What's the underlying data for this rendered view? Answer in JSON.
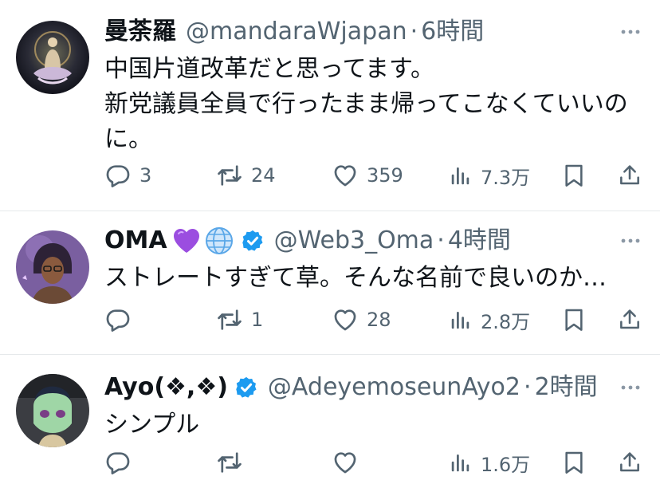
{
  "tweets": [
    {
      "name": "曼荼羅",
      "handle": "@mandaraWjapan",
      "dot": "·",
      "time": "6時間",
      "text_lines": [
        "中国片道改革だと思ってます。",
        "新党議員全員で行ったまま帰ってこなくていいの",
        "に。"
      ],
      "replies": "3",
      "retweets": "24",
      "likes": "359",
      "views": "7.3万"
    },
    {
      "name": "OMA",
      "name_emoji": "💜🌐",
      "handle": "@Web3_Oma",
      "dot": "·",
      "time": "4時間",
      "text_lines": [
        "ストレートすぎて草。そんな名前で良いのか…"
      ],
      "replies": "",
      "retweets": "1",
      "likes": "28",
      "views": "2.8万"
    },
    {
      "name": "Ayo(❖,❖)",
      "handle": "@AdeyemoseunAyo2",
      "dot": "·",
      "time": "2時間",
      "text_lines": [
        "シンプル"
      ],
      "replies": "",
      "retweets": "",
      "likes": "",
      "views": "1.6万"
    }
  ],
  "colors": {
    "text": "#0f1419",
    "secondary": "#536471",
    "verified": "#1d9bf0",
    "divider": "#e6e9eb"
  },
  "icons": [
    "reply-icon",
    "retweet-icon",
    "like-icon",
    "views-icon",
    "bookmark-icon",
    "share-icon",
    "more-icon",
    "verified-badge-icon",
    "purple-heart-emoji",
    "globe-emoji"
  ]
}
